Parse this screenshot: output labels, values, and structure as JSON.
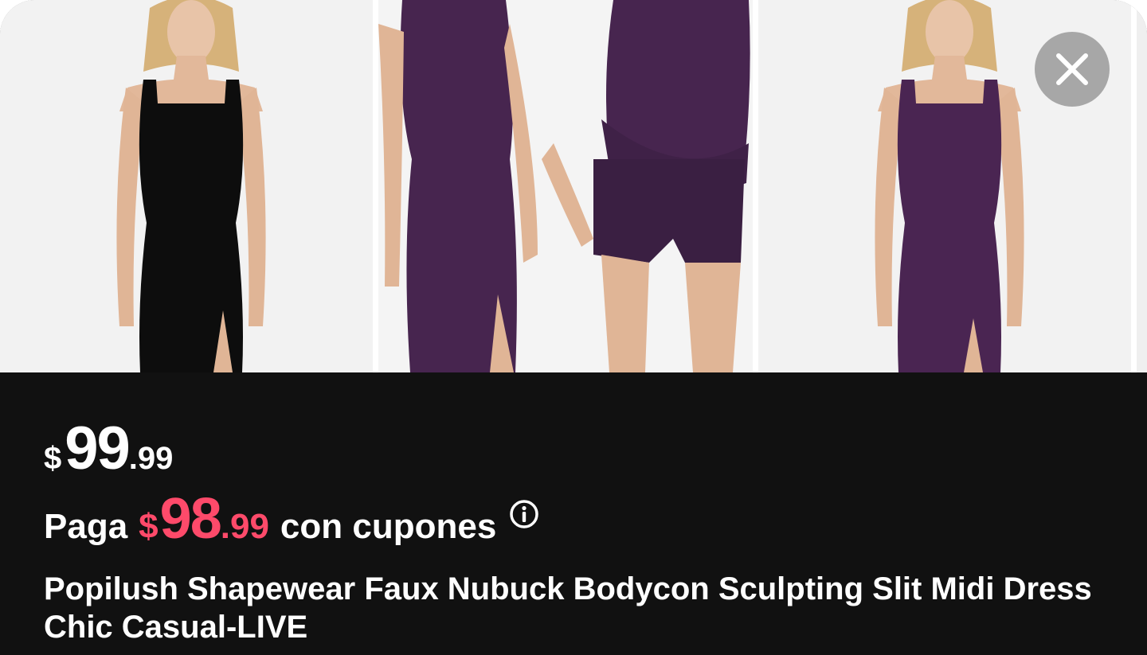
{
  "gallery": {
    "photos": [
      {
        "name": "product-photo-black-dress",
        "dress_color": "#0d0d0d"
      },
      {
        "name": "product-photo-purple-front",
        "dress_color": "#47254f"
      },
      {
        "name": "product-photo-purple-shorts",
        "dress_color": "#47254f"
      },
      {
        "name": "product-photo-purple-model",
        "dress_color": "#4a2552"
      }
    ],
    "close_icon": "close-icon"
  },
  "price": {
    "currency": "$",
    "integer": "99",
    "decimal": ".99"
  },
  "coupon": {
    "prefix": "Paga",
    "currency": "$",
    "integer": "98",
    "decimal": ".99",
    "suffix": "con cupones",
    "accent_color": "#fe4a6a",
    "info_icon": "info-icon"
  },
  "product": {
    "title": "Popilush Shapewear Faux Nubuck Bodycon Sculpting Slit Midi Dress Chic Casual-LIVE"
  }
}
